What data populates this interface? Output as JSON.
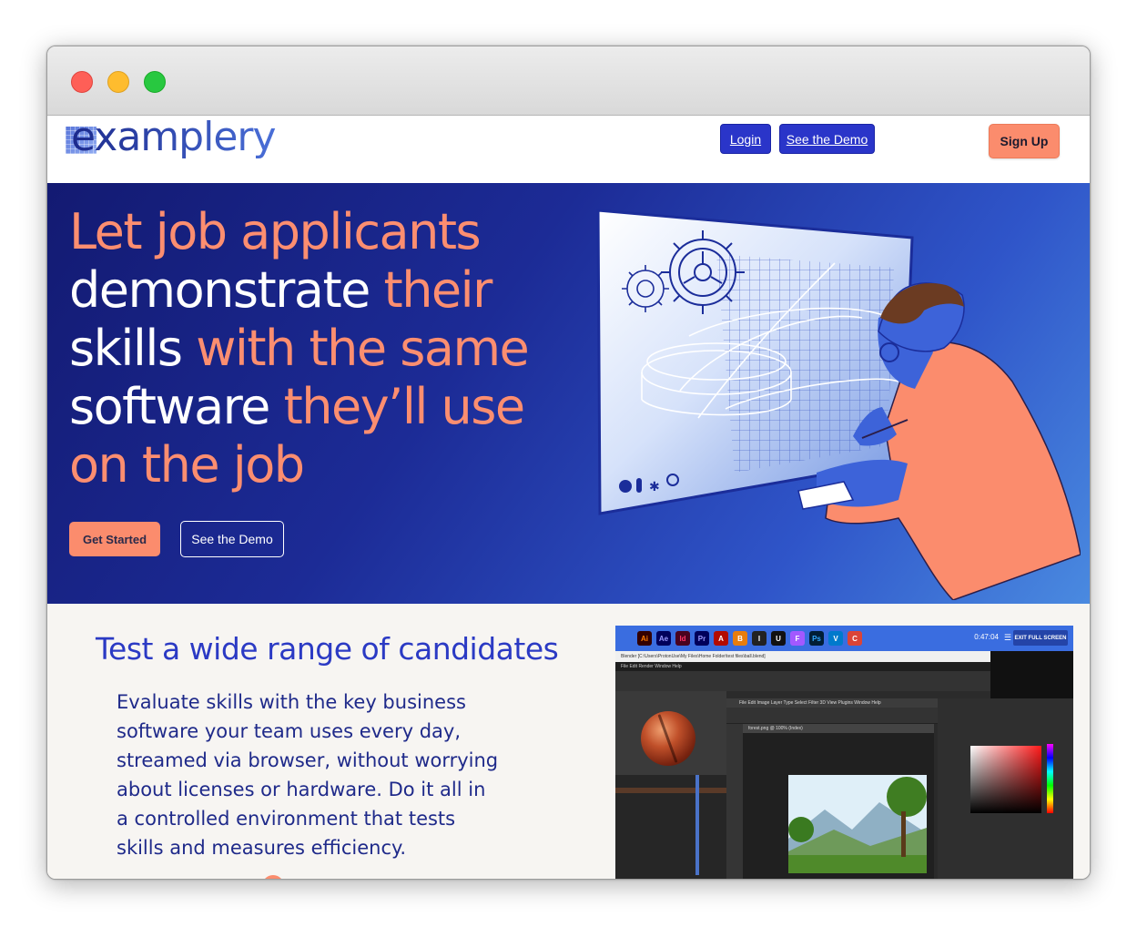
{
  "brand": {
    "logo_text": "examplery"
  },
  "nav": {
    "login_label": "Login",
    "demo_label": "See the Demo",
    "signup_label": "Sign Up"
  },
  "hero": {
    "headline": {
      "line1_orange": "Let job applicants",
      "line2_white": "demonstrate ",
      "line2_orange": "their",
      "line3_white": "skills ",
      "line3_orange": "with the same",
      "line4_white": "software ",
      "line4_orange": "they’ll use",
      "line5_orange": "on the job"
    },
    "get_started_label": "Get Started",
    "demo_label": "See the Demo"
  },
  "section": {
    "title": "Test a wide range of candidates",
    "body": "Evaluate skills with the key business software your team uses every day, streamed via browser, without worrying about licenses or hardware. Do it all in a controlled environment that tests skills and measures efficiency."
  },
  "app_screenshot": {
    "timer": "0:47:04",
    "exit_label": "EXIT FULL SCREEN",
    "blender_title": "Blender [C:\\Users\\ProtonUse\\My Files\\Home Folder\\test files\\ball.blend]",
    "blender_menu": "File   Edit   Render   Window   Help",
    "ps_menu": "File  Edit  Image  Layer  Type  Select  Filter  3D  View  Plugins  Window  Help",
    "ps_tab": "forest.png @ 100% (Index)",
    "taskbar_icons": [
      {
        "name": "illustrator-icon",
        "label": "Ai",
        "color": "#ff7c00",
        "bg": "#330000"
      },
      {
        "name": "after-effects-icon",
        "label": "Ae",
        "color": "#9999ff",
        "bg": "#00005b"
      },
      {
        "name": "indesign-icon",
        "label": "Id",
        "color": "#ff3366",
        "bg": "#49021f"
      },
      {
        "name": "premiere-icon",
        "label": "Pr",
        "color": "#9999ff",
        "bg": "#00005b"
      },
      {
        "name": "acrobat-icon",
        "label": "A",
        "color": "#ffffff",
        "bg": "#b30b00"
      },
      {
        "name": "blender-icon",
        "label": "B",
        "color": "#ffffff",
        "bg": "#e87d0d"
      },
      {
        "name": "inkscape-icon",
        "label": "I",
        "color": "#ffffff",
        "bg": "#222222"
      },
      {
        "name": "unity-icon",
        "label": "U",
        "color": "#ffffff",
        "bg": "#111111"
      },
      {
        "name": "figma-icon",
        "label": "F",
        "color": "#ffffff",
        "bg": "#a259ff"
      },
      {
        "name": "photoshop-icon",
        "label": "Ps",
        "color": "#31a8ff",
        "bg": "#001e36"
      },
      {
        "name": "vscode-icon",
        "label": "V",
        "color": "#ffffff",
        "bg": "#007acc"
      },
      {
        "name": "chrome-icon",
        "label": "C",
        "color": "#ffffff",
        "bg": "#db4437"
      }
    ]
  },
  "colors": {
    "accent_orange": "#fb8c6d",
    "brand_blue": "#2a35c9",
    "hero_dark": "#131a72",
    "hero_light": "#4a8ae0",
    "section_title": "#2b3ac4"
  }
}
